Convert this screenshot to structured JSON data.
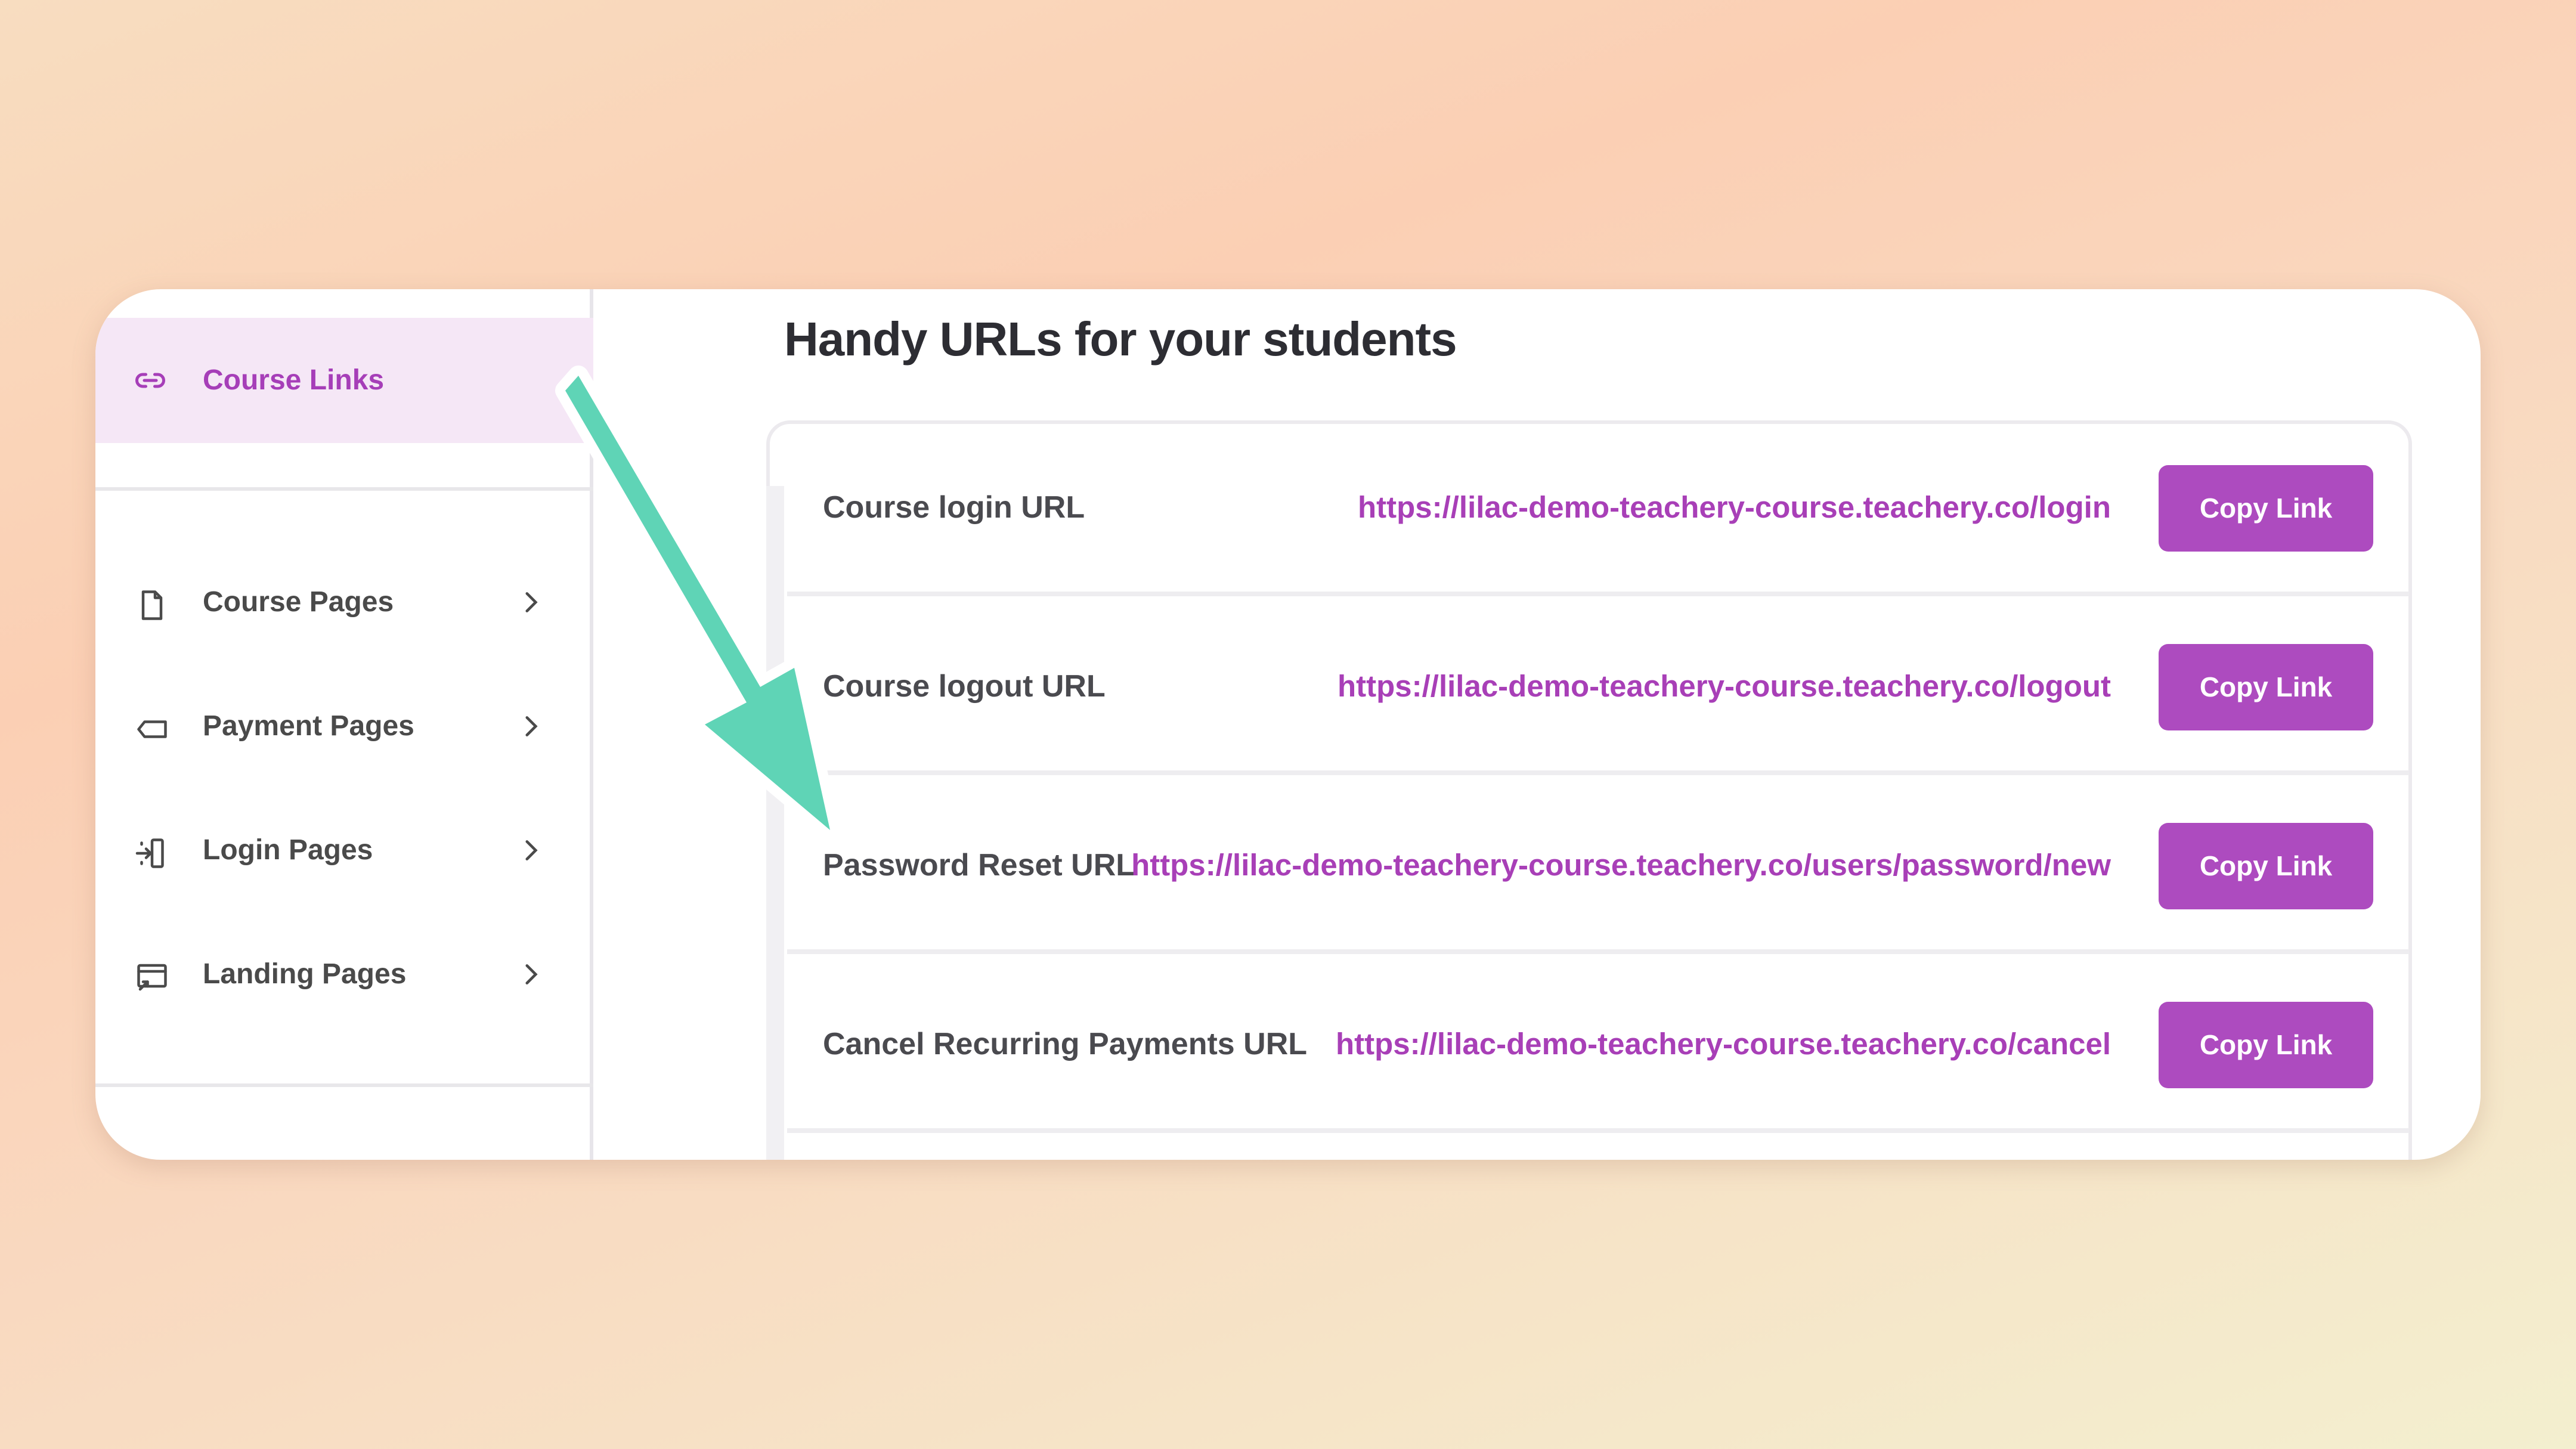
{
  "sidebar": {
    "active_item": {
      "label": "Course Links",
      "icon": "link-icon"
    },
    "items": [
      {
        "label": "Course Pages",
        "icon": "file-icon"
      },
      {
        "label": "Payment Pages",
        "icon": "tag-icon"
      },
      {
        "label": "Login Pages",
        "icon": "login-icon"
      },
      {
        "label": "Landing Pages",
        "icon": "landing-page-icon"
      }
    ]
  },
  "main": {
    "title": "Handy URLs for your students",
    "rows": [
      {
        "label": "Course login URL",
        "url": "https://lilac-demo-teachery-course.teachery.co/login",
        "button": "Copy Link"
      },
      {
        "label": "Course logout URL",
        "url": "https://lilac-demo-teachery-course.teachery.co/logout",
        "button": "Copy Link"
      },
      {
        "label": "Password Reset URL",
        "url": "https://lilac-demo-teachery-course.teachery.co/users/password/new",
        "button": "Copy Link"
      },
      {
        "label": "Cancel Recurring Payments URL",
        "url": "https://lilac-demo-teachery-course.teachery.co/cancel",
        "button": "Copy Link"
      }
    ]
  },
  "colors": {
    "accent": "#ad4bbf",
    "accent_text": "#a83fb7",
    "active_bg": "#f5e7f6",
    "arrow": "#5fd4b6"
  }
}
